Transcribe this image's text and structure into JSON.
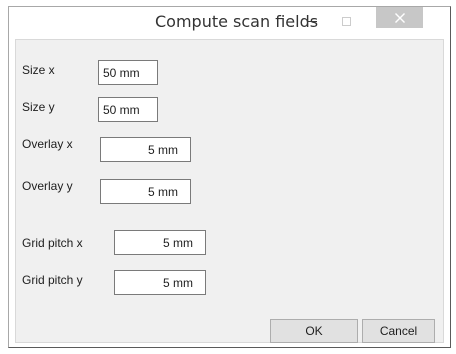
{
  "window": {
    "title": "Compute scan fields"
  },
  "fields": [
    {
      "label": "Size x",
      "value": "50 mm"
    },
    {
      "label": "Size y",
      "value": "50 mm"
    },
    {
      "label": "Overlay x",
      "value": "5 mm"
    },
    {
      "label": "Overlay y",
      "value": "5 mm"
    },
    {
      "label": "Grid pitch x",
      "value": "5 mm"
    },
    {
      "label": "Grid pitch y",
      "value": "5 mm"
    }
  ],
  "buttons": {
    "ok_label": "OK",
    "cancel_label": "Cancel"
  }
}
